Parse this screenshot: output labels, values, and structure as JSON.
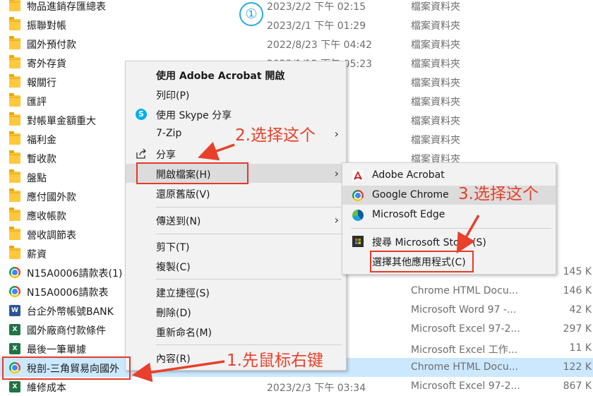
{
  "files": [
    {
      "name": "物品進銷存匯總表",
      "date": "2023/2/2 下午 02:15",
      "type": "檔案資料夾",
      "size": "",
      "icon": "folder-icon"
    },
    {
      "name": "振聯對帳",
      "date": "2023/2/1 下午 01:29",
      "type": "檔案資料夾",
      "size": "",
      "icon": "folder-icon"
    },
    {
      "name": "國外預付款",
      "date": "2022/8/23 下午 04:42",
      "type": "檔案資料夾",
      "size": "",
      "icon": "folder-icon"
    },
    {
      "name": "寄外存貨",
      "date": "2023/1/12 下午 05:23",
      "type": "檔案資料夾",
      "size": "",
      "icon": "folder-icon"
    },
    {
      "name": "報關行",
      "date": "06:02",
      "type": "檔案資料夾",
      "size": "",
      "icon": "folder-icon"
    },
    {
      "name": "匯評",
      "date": "01:00",
      "type": "檔案資料夾",
      "size": "",
      "icon": "folder-icon"
    },
    {
      "name": "對帳單金額重大",
      "date": "03:56",
      "type": "檔案資料夾",
      "size": "",
      "icon": "folder-icon"
    },
    {
      "name": "福利金",
      "date": "05:54",
      "type": "檔案資料夾",
      "size": "",
      "icon": "folder-icon"
    },
    {
      "name": "暫收款",
      "date": "04:42",
      "type": "檔案資料夾",
      "size": "",
      "icon": "folder-icon"
    },
    {
      "name": "盤點",
      "date": "",
      "type": "",
      "size": "",
      "icon": "folder-icon"
    },
    {
      "name": "應付國外款",
      "date": "",
      "type": "",
      "size": "",
      "icon": "folder-icon"
    },
    {
      "name": "應收帳款",
      "date": "",
      "type": "",
      "size": "",
      "icon": "folder-icon"
    },
    {
      "name": "營收調節表",
      "date": "",
      "type": "",
      "size": "",
      "icon": "folder-icon"
    },
    {
      "name": "薪資",
      "date": "",
      "type": "",
      "size": "",
      "icon": "folder-icon"
    },
    {
      "name": "N15A0006請款表(1)",
      "date": "",
      "type": "",
      "size": "145 K",
      "icon": "chrome-icon"
    },
    {
      "name": "N15A0006請款表",
      "date": "F 10:21",
      "type": "Chrome HTML Docu...",
      "size": "146 K",
      "icon": "chrome-icon"
    },
    {
      "name": "台企外幣帳號BANK",
      "date": "F 02:08",
      "type": "Microsoft Word 97 -...",
      "size": "42 K",
      "icon": "word-icon"
    },
    {
      "name": "國外廠商付款條件",
      "date": "02:20",
      "type": "Microsoft Excel 97-2...",
      "size": "297 K",
      "icon": "excel-icon"
    },
    {
      "name": "最後一筆單據",
      "date": "05:23",
      "type": "Microsoft Excel 工作...",
      "size": "11 K",
      "icon": "excel-icon"
    },
    {
      "name": "稅剖-三角貿易向國外",
      "date": "11:31",
      "type": "Chrome HTML Docu...",
      "size": "122 K",
      "icon": "chrome-icon"
    },
    {
      "name": "維修成本",
      "date": "2023/2/3 下午 03:34",
      "type": "Microsoft Excel 97-2...",
      "size": "867 K",
      "icon": "excel-icon"
    }
  ],
  "selected_row": 19,
  "context_menu": {
    "items": [
      {
        "label": "使用 Adobe Acrobat 開啟",
        "bold": true
      },
      {
        "label": "列印(P)"
      },
      {
        "label": "使用 Skype 分享",
        "icon": "skype-icon"
      },
      {
        "label": "7-Zip",
        "submenu": true
      },
      {
        "label": "分享",
        "icon": "share-icon"
      },
      {
        "label": "開啟檔案(H)",
        "submenu": true
      },
      {
        "label": "還原舊版(V)"
      },
      {
        "label": "傳送到(N)",
        "submenu": true
      },
      {
        "label": "剪下(T)"
      },
      {
        "label": "複製(C)"
      },
      {
        "label": "建立捷徑(S)"
      },
      {
        "label": "刪除(D)"
      },
      {
        "label": "重新命名(M)"
      },
      {
        "label": "內容(R)"
      }
    ]
  },
  "open_with_menu": {
    "items": [
      {
        "label": "Adobe Acrobat",
        "icon": "acrobat-icon"
      },
      {
        "label": "Google Chrome",
        "icon": "chrome-icon"
      },
      {
        "label": "Microsoft Edge",
        "icon": "edge-icon"
      },
      {
        "label": "搜尋 Microsoft Store (S)",
        "icon": "store-icon"
      },
      {
        "label": "選擇其他應用程式(C)"
      }
    ]
  },
  "annotations": {
    "circle_number": "①",
    "step1": "1.先鼠标右键",
    "step2": "2.选择这个",
    "step3": "3.选择这个"
  },
  "colors": {
    "annotation": "#e8402a",
    "highlight_box": "#e53a2a",
    "selection": "#cce8ff",
    "circle": "#29a8e0"
  }
}
